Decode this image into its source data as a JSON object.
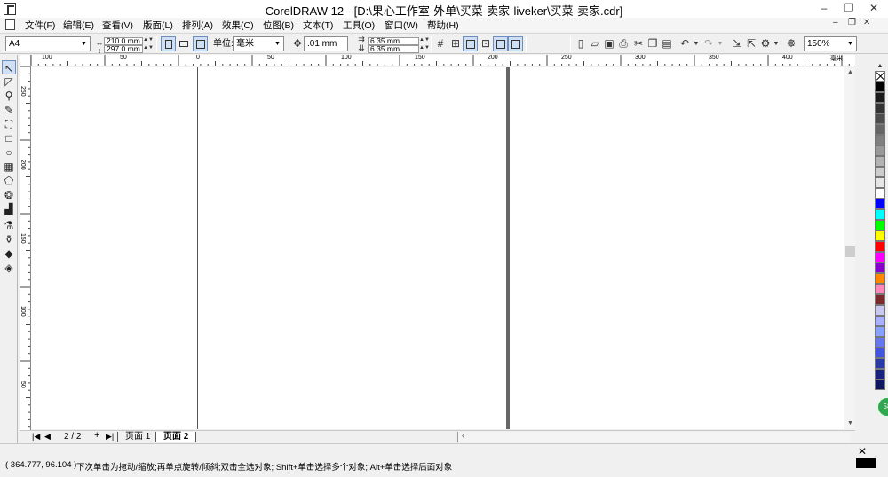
{
  "window": {
    "title": "CorelDRAW 12 - [D:\\果心工作室-外单\\买菜-卖家-liveker\\买菜-卖家.cdr]",
    "minimize": "–",
    "restore": "❐",
    "close": "✕"
  },
  "menu": {
    "items": [
      "文件(F)",
      "编辑(E)",
      "查看(V)",
      "版面(L)",
      "排列(A)",
      "效果(C)",
      "位图(B)",
      "文本(T)",
      "工具(O)",
      "窗口(W)",
      "帮助(H)"
    ],
    "doc_min": "–",
    "doc_restore": "❐",
    "doc_close": "✕"
  },
  "propbar": {
    "paper_size": "A4",
    "width": "210.0 mm",
    "height": "297.0 mm",
    "units_label": "单位:",
    "units_value": "毫米",
    "nudge": ".01 mm",
    "dup_x": "6.35 mm",
    "dup_y": "6.35 mm",
    "zoom": "150%"
  },
  "rulers": {
    "h_ticks": [
      "100",
      "50",
      "0",
      "50",
      "100",
      "150",
      "200",
      "250",
      "300",
      "350",
      "400",
      "毫米"
    ],
    "v_ticks": [
      "250",
      "200",
      "150",
      "100",
      "50"
    ]
  },
  "pages": {
    "nav_first": "|◀",
    "nav_prev": "◀",
    "counter": "2 / 2",
    "nav_add": "+",
    "nav_next": "▶|",
    "tabs": [
      "页面 1",
      "页面 2"
    ]
  },
  "status": {
    "coords": "( 364.777, 96.104 )",
    "hint": "下次单击为拖动/缩放;再单点旋转/倾斜;双击全选对象; Shift+单击选择多个对象; Alt+单击选择后面对象"
  },
  "palette": {
    "colors": [
      "#000000",
      "#1a1a1a",
      "#333333",
      "#4d4d4d",
      "#666666",
      "#808080",
      "#999999",
      "#b3b3b3",
      "#cccccc",
      "#e6e6e6",
      "#ffffff",
      "#0000ff",
      "#00ffff",
      "#00ff00",
      "#ffff00",
      "#ff0000",
      "#ff00ff",
      "#8800cc",
      "#ff8800",
      "#ff88bb",
      "#7a2a2a",
      "#c8c8f0",
      "#aab0ff",
      "#88a0ff",
      "#6677ee",
      "#4455dd",
      "#2a3aa8",
      "#1a2280",
      "#101860"
    ]
  },
  "float_button": "58"
}
